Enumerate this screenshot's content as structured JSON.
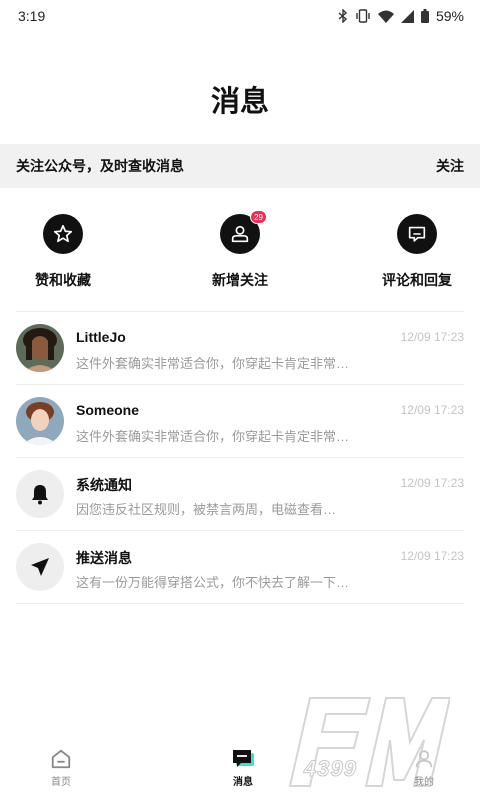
{
  "status_bar": {
    "time": "3:19",
    "battery": "59%",
    "icons": [
      "bluetooth-icon",
      "vibrate-icon",
      "wifi-icon",
      "cell-signal-icon",
      "battery-icon"
    ]
  },
  "page_title": "消息",
  "follow_banner": {
    "text": "关注公众号，及时查收消息",
    "action": "关注"
  },
  "quick_actions": [
    {
      "label": "赞和收藏",
      "icon": "star-icon"
    },
    {
      "label": "新增关注",
      "icon": "add-follower-icon",
      "badge": "29"
    },
    {
      "label": "评论和回复",
      "icon": "comment-icon"
    }
  ],
  "messages": [
    {
      "name": "LittleJo",
      "time": "12/09 17:23",
      "preview": "这件外套确实非常适合你，你穿起卡肯定非常…",
      "avatar": "user-photo-avatar"
    },
    {
      "name": "Someone",
      "time": "12/09 17:23",
      "preview": "这件外套确实非常适合你，你穿起卡肯定非常…",
      "avatar": "user-photo-avatar"
    },
    {
      "name": "系统通知",
      "time": "12/09 17:23",
      "preview": "因您违反社区规则，被禁言两周，电磁查看…",
      "avatar": "bell-icon"
    },
    {
      "name": "推送消息",
      "time": "12/09 17:23",
      "preview": "这有一份万能得穿搭公式，你不快去了解一下…",
      "avatar": "send-arrow-icon"
    }
  ],
  "tabs": [
    {
      "label": "首页",
      "icon": "home-icon"
    },
    {
      "label": "消息",
      "icon": "message-icon",
      "active": true
    },
    {
      "label": "我的",
      "icon": "profile-icon"
    }
  ],
  "watermark": {
    "text": "4399"
  },
  "colors": {
    "badge": "#ef2d56",
    "banner_bg": "#f1f1f1",
    "active_tab_accent": "#3de0c8",
    "text_primary": "#111111",
    "text_muted": "#9a9a9a"
  }
}
